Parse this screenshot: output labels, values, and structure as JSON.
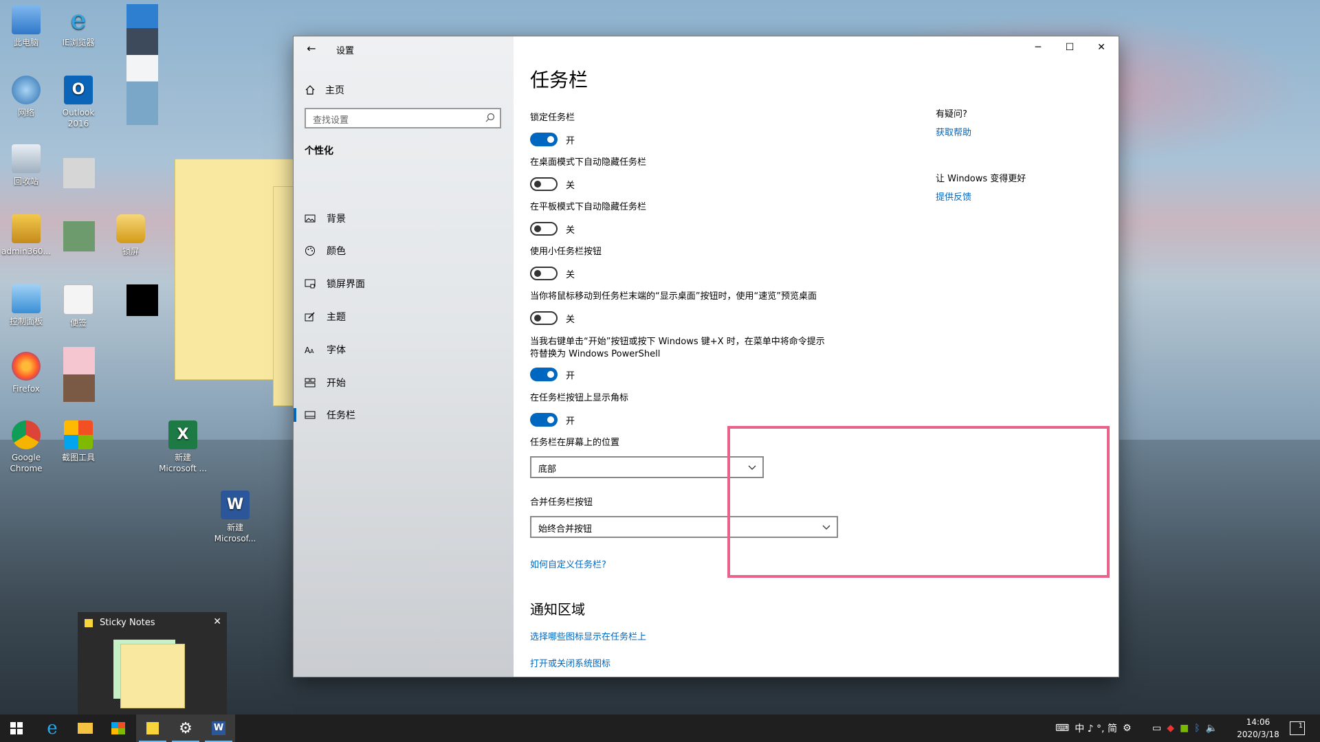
{
  "desktop": {
    "icons": [
      {
        "label": "此电脑"
      },
      {
        "label": "IE浏览器"
      },
      {
        "label": "网络"
      },
      {
        "label": "Outlook 2016"
      },
      {
        "label": "回收站"
      },
      {
        "label": "admin360..."
      },
      {
        "label": "锁屏"
      },
      {
        "label": "控制面板"
      },
      {
        "label": "便签"
      },
      {
        "label": "Firefox"
      },
      {
        "label": "Google Chrome"
      },
      {
        "label": "截图工具"
      },
      {
        "label": "新建 Microsoft ..."
      },
      {
        "label": "新建 Microsof..."
      }
    ]
  },
  "window": {
    "title": "设置",
    "controls": {
      "minimize": "─",
      "maximize": "☐",
      "close": "✕"
    },
    "nav": {
      "home": "主页",
      "search_placeholder": "查找设置",
      "group": "个性化",
      "items": [
        {
          "label": "背景",
          "icon": "picture-icon"
        },
        {
          "label": "颜色",
          "icon": "palette-icon"
        },
        {
          "label": "锁屏界面",
          "icon": "lockscreen-icon"
        },
        {
          "label": "主题",
          "icon": "theme-icon"
        },
        {
          "label": "字体",
          "icon": "font-icon"
        },
        {
          "label": "开始",
          "icon": "start-icon"
        },
        {
          "label": "任务栏",
          "icon": "taskbar-icon",
          "active": true
        }
      ]
    },
    "content": {
      "title": "任务栏",
      "settings": [
        {
          "label": "锁定任务栏",
          "state": "开",
          "on": true
        },
        {
          "label": "在桌面模式下自动隐藏任务栏",
          "state": "关",
          "on": false
        },
        {
          "label": "在平板模式下自动隐藏任务栏",
          "state": "关",
          "on": false
        },
        {
          "label": "使用小任务栏按钮",
          "state": "关",
          "on": false
        },
        {
          "label": "当你将鼠标移动到任务栏末端的“显示桌面”按钮时，使用“速览”预览桌面",
          "state": "关",
          "on": false
        },
        {
          "label": "当我右键单击“开始”按钮或按下 Windows 键+X 时，在菜单中将命令提示符替换为 Windows PowerShell",
          "state": "开",
          "on": true
        },
        {
          "label": "在任务栏按钮上显示角标",
          "state": "开",
          "on": true
        }
      ],
      "position_label": "任务栏在屏幕上的位置",
      "position_value": "底部",
      "combine_label": "合并任务栏按钮",
      "combine_value": "始终合并按钮",
      "customize_link": "如何自定义任务栏?",
      "notify_title": "通知区域",
      "notify_link1": "选择哪些图标显示在任务栏上",
      "notify_link2": "打开或关闭系统图标",
      "side": {
        "q_title": "有疑问?",
        "q_link": "获取帮助",
        "f_title": "让 Windows 变得更好",
        "f_link": "提供反馈"
      }
    }
  },
  "sticky_preview": {
    "title": "Sticky Notes",
    "close": "✕"
  },
  "taskbar": {
    "tray_text": "中 ♪ °, 简",
    "time": "14:06",
    "date": "2020/3/18",
    "notif_count": "1"
  }
}
